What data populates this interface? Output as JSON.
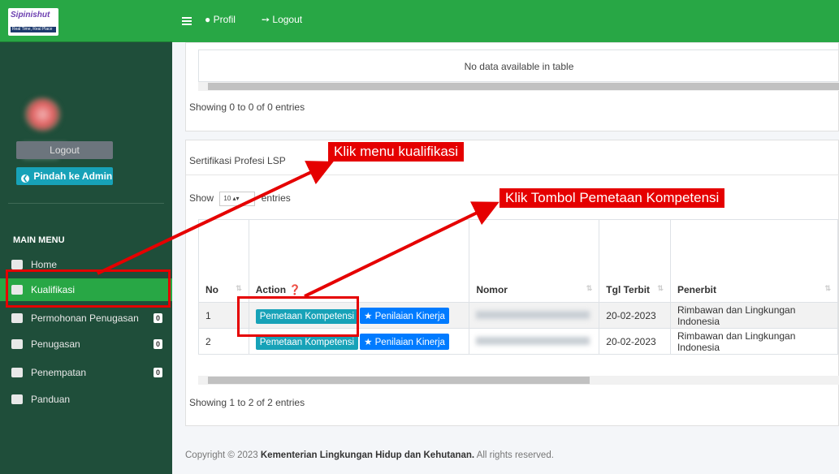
{
  "sidebar": {
    "logo_text": "Sipinishut",
    "logo_tagline": "Real Time, Real Place",
    "logout_label": "Logout",
    "admin_label": "Pindah ke Admin",
    "main_menu_header": "MAIN MENU",
    "items": [
      {
        "label": "Home",
        "icon": "home-icon"
      },
      {
        "label": "Kualifikasi",
        "icon": "briefcase-icon",
        "active": true
      },
      {
        "label": "Permohonan Penugasan",
        "icon": "envelope-icon",
        "badge": "0"
      },
      {
        "label": "Penugasan",
        "icon": "briefcase-icon",
        "badge": "0"
      },
      {
        "label": "Penempatan",
        "icon": "computer-icon",
        "badge": "0"
      },
      {
        "label": "Panduan",
        "icon": "book-icon"
      }
    ]
  },
  "topbar": {
    "profil_label": "Profil",
    "logout_label": "Logout"
  },
  "card1": {
    "no_data": "No data available in table",
    "info": "Showing 0 to 0 of 0 entries"
  },
  "card2": {
    "title": "Sertifikasi Profesi LSP",
    "show_label": "Show",
    "show_value": "10",
    "entries_label": "entries",
    "columns": [
      "No",
      "Action",
      "Nomor",
      "Tgl Terbit",
      "Penerbit"
    ],
    "rows": [
      {
        "no": "1",
        "btn1": "Pemetaan Kompetensi",
        "btn2": "Penilaian Kinerja",
        "tgl": "20-02-2023",
        "penerbit": "Rimbawan dan Lingkungan Indonesia"
      },
      {
        "no": "2",
        "btn1": "Pemetaan Kompetensi",
        "btn2": "Penilaian Kinerja",
        "tgl": "20-02-2023",
        "penerbit": "Rimbawan dan Lingkungan Indonesia"
      }
    ],
    "info": "Showing 1 to 2 of 2 entries"
  },
  "footer": {
    "prefix": "Copyright © 2023",
    "org": "Kementerian Lingkungan Hidup dan Kehutanan.",
    "suffix": "All rights reserved."
  },
  "annotations": {
    "callout1": "Klik menu kualifikasi",
    "callout2": "Klik Tombol Pemetaan Kompetensi"
  },
  "colors": {
    "brand_green": "#28a745",
    "sidebar_bg": "#1f4e3a",
    "annotation_red": "#e50000"
  }
}
